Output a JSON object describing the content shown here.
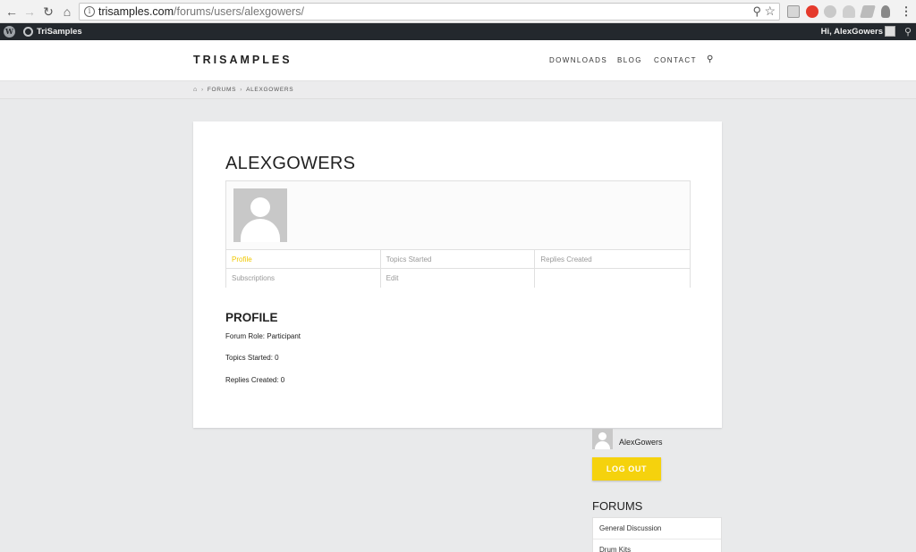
{
  "browser": {
    "url_host": "trisamples.com",
    "url_path": "/forums/users/alexgowers/"
  },
  "wp_admin_bar": {
    "site_name": "TriSamples",
    "greeting": "Hi, AlexGowers"
  },
  "header": {
    "logo": "TRISAMPLES",
    "nav": [
      {
        "label": "DOWNLOADS"
      },
      {
        "label": "BLOG"
      },
      {
        "label": "CONTACT"
      }
    ]
  },
  "breadcrumb": {
    "items": [
      "FORUMS",
      "ALEXGOWERS"
    ]
  },
  "profile": {
    "title": "ALEXGOWERS",
    "menu": [
      [
        "Profile",
        "Topics Started",
        "Replies Created"
      ],
      [
        "Subscriptions",
        "Edit",
        ""
      ]
    ],
    "active_menu_item": "Profile",
    "section_title": "PROFILE",
    "forum_role": "Forum Role: Participant",
    "topics_started": "Topics Started: 0",
    "replies_created": "Replies Created: 0"
  },
  "sidebar": {
    "username": "AlexGowers",
    "logout_label": "LOG OUT",
    "forums_title": "FORUMS",
    "forums": [
      "General Discussion",
      "Drum Kits"
    ]
  },
  "colors": {
    "accent": "#f5d20d",
    "admin_bar": "#23282d"
  }
}
